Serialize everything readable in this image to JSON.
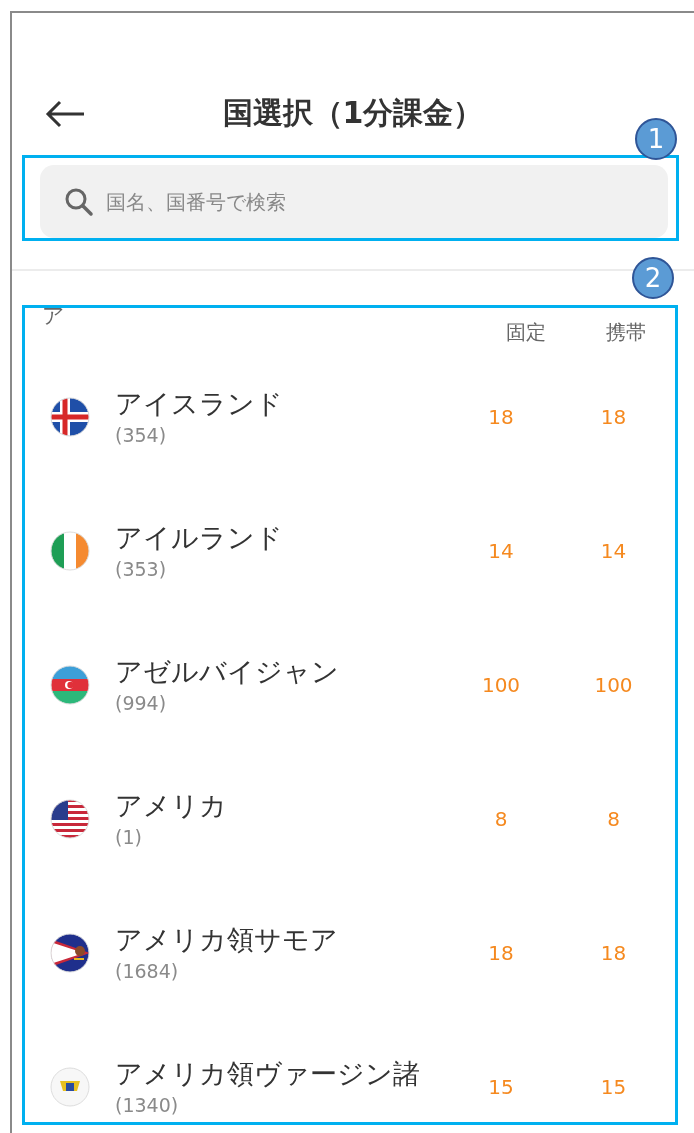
{
  "header": {
    "title": "国選択（1分課金）"
  },
  "search": {
    "placeholder": "国名、国番号で検索"
  },
  "list": {
    "section": "ア",
    "columns": [
      "固定",
      "携帯"
    ],
    "rows": [
      {
        "name": "アイスランド",
        "code": "(354)",
        "landline": "18",
        "mobile": "18"
      },
      {
        "name": "アイルランド",
        "code": "(353)",
        "landline": "14",
        "mobile": "14"
      },
      {
        "name": "アゼルバイジャン",
        "code": "(994)",
        "landline": "100",
        "mobile": "100"
      },
      {
        "name": "アメリカ",
        "code": "(1)",
        "landline": "8",
        "mobile": "8"
      },
      {
        "name": "アメリカ領サモア",
        "code": "(1684)",
        "landline": "18",
        "mobile": "18"
      },
      {
        "name": "アメリカ領ヴァージン諸",
        "code": "(1340)",
        "landline": "15",
        "mobile": "15"
      }
    ]
  },
  "annotations": [
    "1",
    "2"
  ]
}
